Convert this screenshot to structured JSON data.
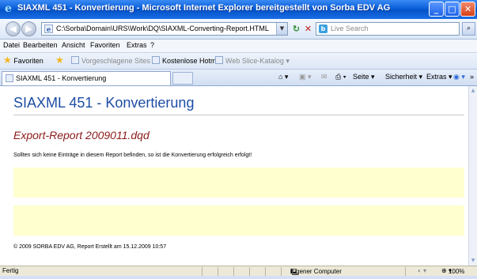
{
  "window": {
    "title": "SIAXML 451 - Konvertierung - Microsoft Internet Explorer bereitgestellt von Sorba EDV AG"
  },
  "address_bar": {
    "url": "C:\\Sorba\\Domain\\URS\\Work\\DQ\\SIAXML-Converting-Report.HTML",
    "search_placeholder": "Live Search"
  },
  "menu": [
    "Datei",
    "Bearbeiten",
    "Ansicht",
    "Favoriten",
    "Extras",
    "?"
  ],
  "favorites_bar": {
    "favorites": "Favoriten",
    "suggested": "Vorgeschlagene Sites ▾",
    "hotmail": "Kostenlose Hotmail",
    "webslice": "Web Slice-Katalog ▾"
  },
  "tab": {
    "title": "SIAXML 451 - Konvertierung"
  },
  "command_bar": {
    "page": "Seite ▾",
    "security": "Sicherheit ▾",
    "tools": "Extras ▾"
  },
  "page": {
    "heading": "SIAXML 451 - Konvertierung",
    "subheading": "Export-Report 2009011.dqd",
    "note": "Sollten sich keine Einträge in diesem Report befinden, so ist die Konvertierung erfolgreich erfolgt!",
    "footer": "© 2009 SORBA EDV AG, Report Erstellt am 15.12.2009 10:57"
  },
  "status_bar": {
    "status": "Fertig",
    "zone": "Eigener Computer",
    "zoom": "100%"
  },
  "colors": {
    "heading": "#1d4da5",
    "subheading": "#8b1a1a",
    "band": "#ffffd0",
    "titlebar": "#0a5fd8"
  }
}
